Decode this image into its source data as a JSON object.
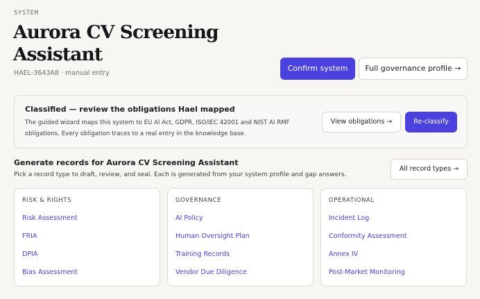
{
  "header": {
    "eyebrow": "SYSTEM",
    "title": "Aurora CV Screening Assistant",
    "meta": "HAEL-3643A8 · manual entry",
    "confirm_label": "Confirm system",
    "governance_label": "Full governance profile →"
  },
  "classification": {
    "title": "Classified — review the obligations Hael mapped",
    "description": "The guided wizard maps this system to EU AI Act, GDPR, ISO/IEC 42001 and NIST AI RMF obligations. Every obligation traces to a real entry in the knowledge base.",
    "view_label": "View obligations →",
    "reclassify_label": "Re-classify"
  },
  "records": {
    "title": "Generate records for Aurora CV Screening Assistant",
    "description": "Pick a record type to draft, review, and seal. Each is generated from your system profile and gap answers.",
    "all_label": "All record types →",
    "columns": [
      {
        "heading": "RISK & RIGHTS",
        "items": [
          "Risk Assessment",
          "FRIA",
          "DPIA",
          "Bias Assessment"
        ]
      },
      {
        "heading": "GOVERNANCE",
        "items": [
          "AI Policy",
          "Human Oversight Plan",
          "Training Records",
          "Vendor Due Diligence"
        ]
      },
      {
        "heading": "OPERATIONAL",
        "items": [
          "Incident Log",
          "Conformity Assessment",
          "Annex IV",
          "Post-Market Monitoring"
        ]
      }
    ]
  },
  "colors": {
    "accent": "#4b42dd",
    "link": "#4a40c8",
    "background": "#f7f6f3"
  }
}
